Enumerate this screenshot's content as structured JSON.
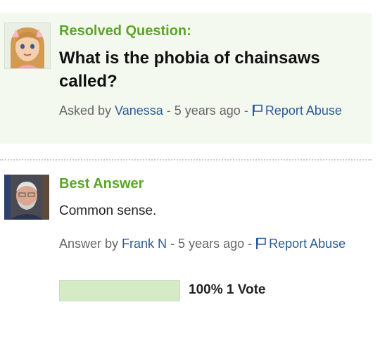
{
  "question": {
    "section_label": "Resolved Question:",
    "text": "What is the phobia of chainsaws called?",
    "meta": {
      "prefix": "Asked by ",
      "author": "Vanessa",
      "time": " - 5 years ago - ",
      "report_label": "Report Abuse"
    }
  },
  "answer": {
    "section_label": "Best Answer",
    "text": "Common sense.",
    "meta": {
      "prefix": "Answer by ",
      "author": "Frank N",
      "time": " - 5 years ago - ",
      "report_label": "Report Abuse"
    },
    "votes": {
      "percent": 100,
      "text": "100% 1 Vote"
    }
  },
  "colors": {
    "accent_green": "#5aa626",
    "link_blue": "#2c5a96",
    "panel_bg": "#f4f9f0",
    "vote_fill": "#d5ebc6"
  },
  "icons": {
    "question_avatar": "cartoon-girl-avatar",
    "answer_avatar": "man-photo-avatar",
    "report": "flag-icon"
  }
}
